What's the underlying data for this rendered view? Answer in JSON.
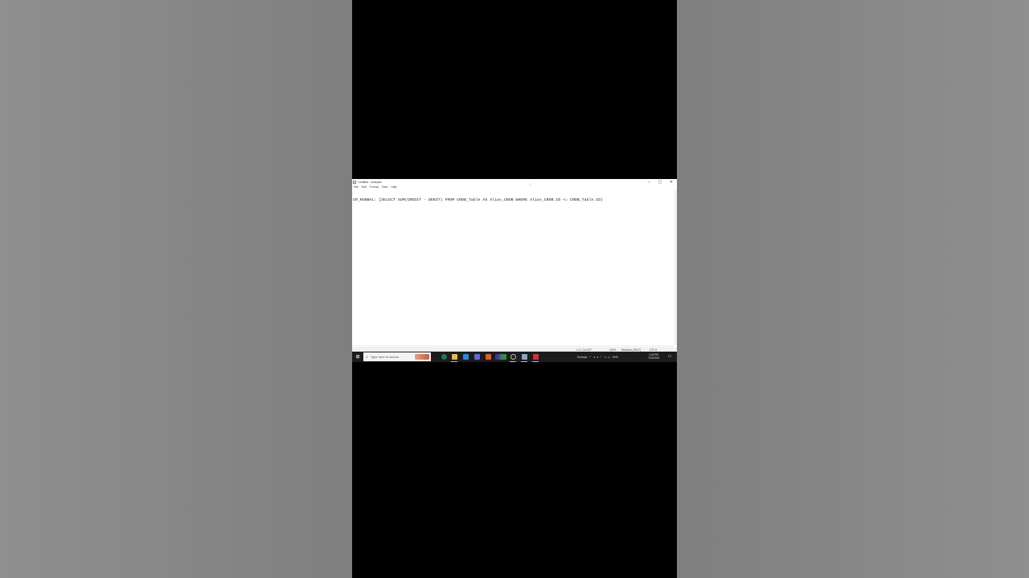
{
  "window": {
    "title": "*Untitled - Notepad",
    "controls": {
      "minimize": "–",
      "maximize": "▢",
      "close": "✕"
    }
  },
  "menu": {
    "items": [
      "File",
      "Edit",
      "Format",
      "View",
      "Help"
    ]
  },
  "editor": {
    "content": "CR_RUNBAL: [SELECT SUM(CREDIT - DEBIT) FROM CRDB_Table AS Alias_CRDB WHERE Alias_CRDB.ID <= CRDB_Table.ID)"
  },
  "status": {
    "position": "Ln 1, Col 107",
    "zoom": "100%",
    "line_ending": "Windows (CRLF)",
    "encoding": "UTF-8"
  },
  "taskbar": {
    "search_placeholder": "Type here to search",
    "tray_label": "Desktop",
    "language": "ENG",
    "time": "3:49 PM",
    "date": "7/10/2024"
  },
  "icons": {
    "start": "windows-start-icon",
    "search": "search-icon",
    "notifications": "notification-icon"
  },
  "colors": {
    "taskbar": "#1c1c1c",
    "screen_bg": "#ffffff",
    "video_bg": "#000000",
    "side_bg": "#888888"
  }
}
